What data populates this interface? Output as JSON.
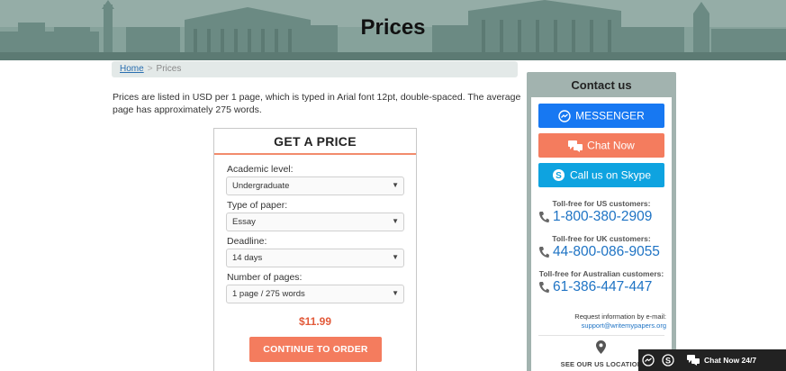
{
  "hero": {
    "title": "Prices"
  },
  "breadcrumb": {
    "home": "Home",
    "separator": ">",
    "current": "Prices"
  },
  "intro": "Prices are listed in USD per 1 page, which is typed in Arial font 12pt, double-spaced. The average page has approximately 275 words.",
  "price_form": {
    "title": "GET A PRICE",
    "fields": [
      {
        "label": "Academic level:",
        "value": "Undergraduate"
      },
      {
        "label": "Type of paper:",
        "value": "Essay"
      },
      {
        "label": "Deadline:",
        "value": "14 days"
      },
      {
        "label": "Number of pages:",
        "value": "1 page / 275 words"
      }
    ],
    "price": "$11.99",
    "order_button": "CONTINUE TO ORDER"
  },
  "contact": {
    "title": "Contact us",
    "messenger": "MESSENGER",
    "chat": "Chat Now",
    "skype": "Call us on Skype",
    "phones": [
      {
        "label": "Toll-free for US customers:",
        "number": "1-800-380-2909"
      },
      {
        "label": "Toll-free for UK customers:",
        "number": "44-800-086-9055"
      },
      {
        "label": "Toll-free for Australian customers:",
        "number": "61-386-447-447"
      }
    ],
    "request_text": "Request information by e-mail:",
    "email": "support@writemypapers.org",
    "location": "SEE OUR US LOCATION"
  },
  "chatbar": {
    "label": "Chat Now 24/7"
  },
  "colors": {
    "accent": "#f47c5e",
    "link": "#1e73c4",
    "messenger": "#1778f2",
    "skype": "#0ea3e0",
    "hero": "#7d9a93"
  }
}
